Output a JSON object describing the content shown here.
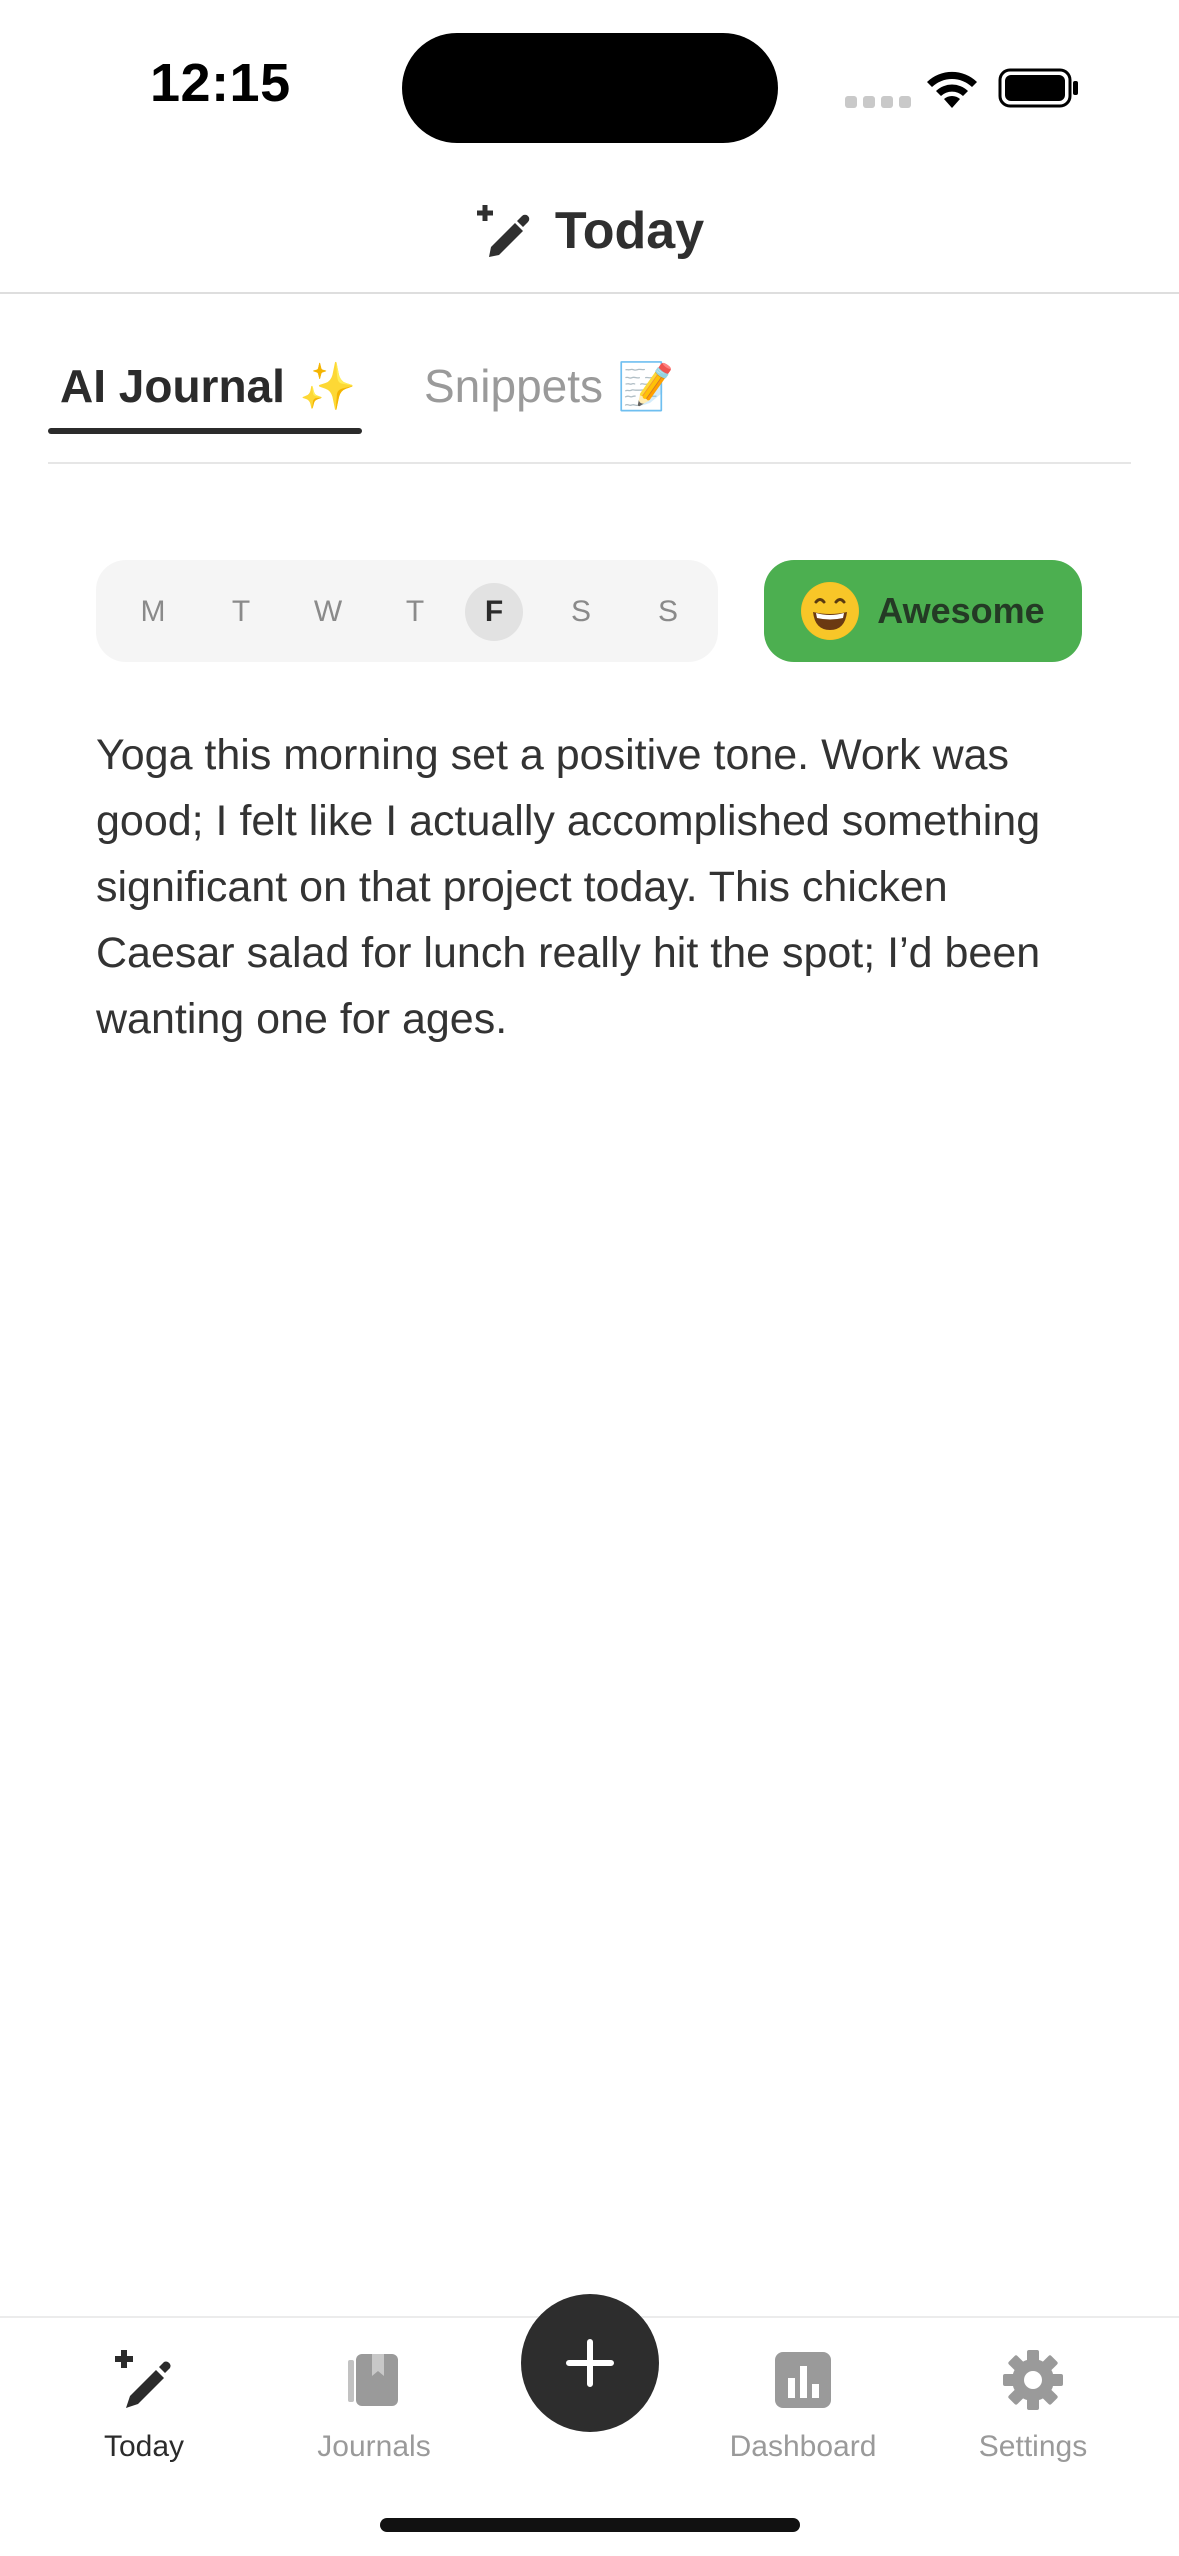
{
  "status_bar": {
    "time": "12:15"
  },
  "header": {
    "title": "Today",
    "icon": "pencil-sparkle-icon"
  },
  "tabs": [
    {
      "label": "AI Journal",
      "emoji": "✨",
      "active": true
    },
    {
      "label": "Snippets",
      "emoji": "📝",
      "active": false
    }
  ],
  "week": {
    "days": [
      "M",
      "T",
      "W",
      "T",
      "F",
      "S",
      "S"
    ],
    "selected_index": 4
  },
  "mood": {
    "label": "Awesome",
    "color": "#4caf50",
    "icon": "grinning-face-icon"
  },
  "journal": {
    "text": "Yoga this morning set a positive tone. Work was good; I felt like I actually accomplished something significant on that project today. This chicken Caesar salad for lunch really hit the spot; I’d been wanting one for ages."
  },
  "bottom_nav": {
    "items": [
      {
        "label": "Today",
        "icon": "pencil-sparkle-icon",
        "active": true
      },
      {
        "label": "Journals",
        "icon": "journals-icon",
        "active": false
      },
      {
        "label": "Dashboard",
        "icon": "bar-chart-icon",
        "active": false
      },
      {
        "label": "Settings",
        "icon": "gear-icon",
        "active": false
      }
    ],
    "add_button_icon": "plus-icon"
  },
  "colors": {
    "accent": "#4caf50",
    "text": "#2b2b2b",
    "muted": "#9a9a9a",
    "fab": "#2d2d2d"
  }
}
